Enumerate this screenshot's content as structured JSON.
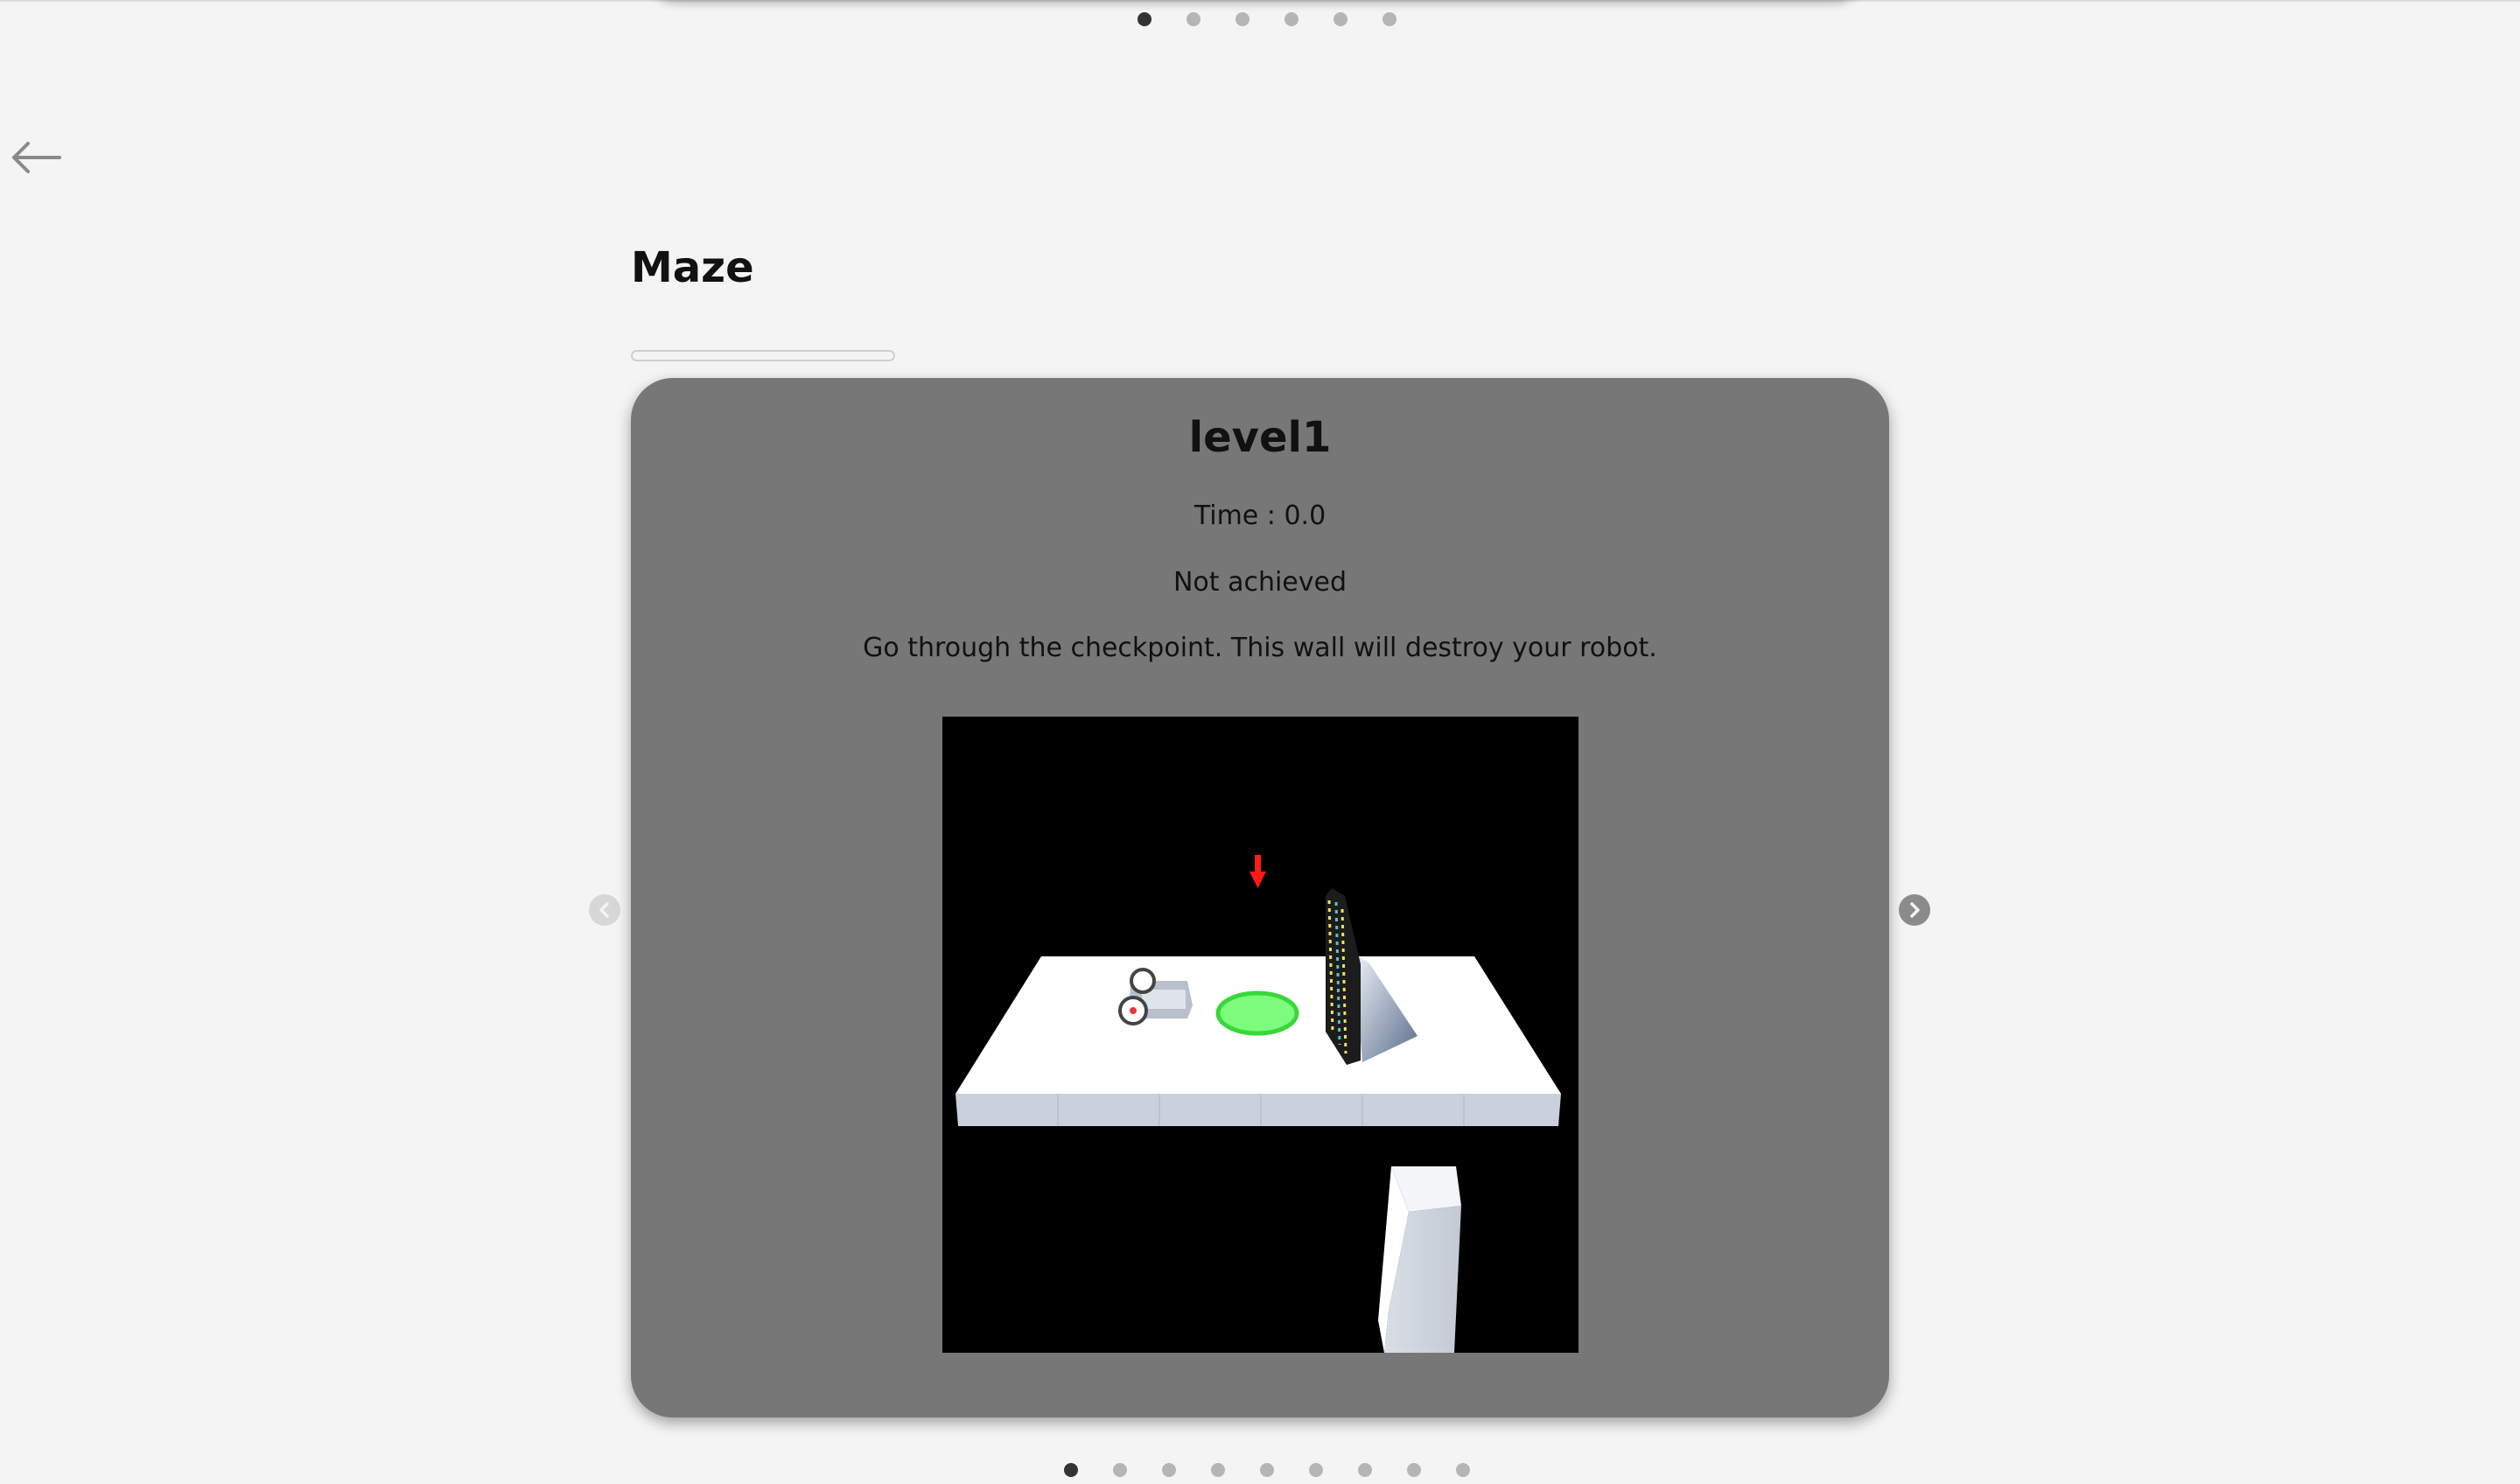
{
  "page": {
    "title": "Maze",
    "progress": 0
  },
  "carousel_top": {
    "dot_count": 6,
    "active_index": 0
  },
  "level": {
    "title": "level1",
    "time": "Time : 0.0",
    "status": "Not achieved",
    "description": "Go through the checkpoint. This wall will destroy your robot."
  },
  "carousel_bottom": {
    "dot_count": 9,
    "active_index": 0
  },
  "icons": {
    "back": "arrow-left-icon",
    "prev": "chevron-left-icon",
    "next": "chevron-right-icon"
  },
  "colors": {
    "card": "#777777",
    "checkpoint": "#44e044",
    "marker": "#ff1a1a",
    "dot_active": "#333333",
    "dot_inactive": "#b5b5b5"
  }
}
